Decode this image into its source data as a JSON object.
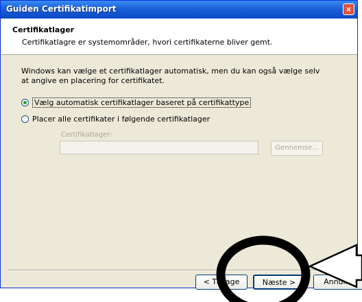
{
  "window": {
    "title": "Guiden Certifikatimport",
    "close_glyph": "×"
  },
  "header": {
    "title": "Certifikatlager",
    "subtitle": "Certifikatlagre er systemområder, hvori certifikaterne bliver gemt."
  },
  "body": {
    "description": "Windows kan vælge et certifikatlager automatisk, men du kan også vælge selv at angive en placering for certifikatet.",
    "options": [
      {
        "label": "Vælg automatisk certifikatlager baseret på certifikattype",
        "selected": true
      },
      {
        "label": "Placer alle certifikater i følgende certifikatlager",
        "selected": false
      }
    ],
    "store_label": "Certifikatlager:",
    "store_value": "",
    "browse_label": "Gennemse..."
  },
  "buttons": {
    "back": "< Tilbage",
    "next": "Næste >",
    "cancel": "Annuller"
  },
  "annotation": {
    "circle_color": "#000000",
    "arrow_color": "#000000"
  }
}
